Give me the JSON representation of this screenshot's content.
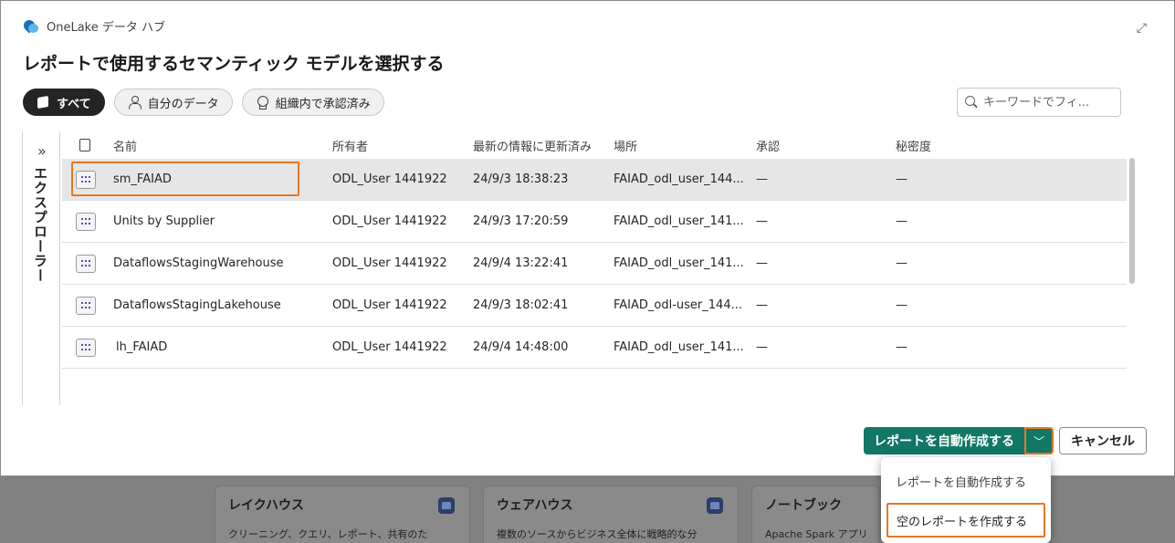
{
  "background": {
    "cards": [
      {
        "title": "レイクハウス",
        "desc": "クリーニング、クエリ、レポート、共有のた"
      },
      {
        "title": "ウェアハウス",
        "desc": "複数のソースからビジネス全体に戦略的な分"
      },
      {
        "title": "ノートブック",
        "desc": "Apache Spark アプリケ"
      }
    ]
  },
  "dialog": {
    "hub_name": "OneLake データ ハブ",
    "title": "レポートで使用するセマンティック モデルを選択する",
    "filters": [
      "すべて",
      "自分のデータ",
      "組織内で承認済み"
    ],
    "search_placeholder": "キーワードでフィ...",
    "explorer_label": "エクスプローラー",
    "columns": [
      "名前",
      "所有者",
      "最新の情報に更新済み",
      "場所",
      "承認",
      "秘密度"
    ],
    "rows": [
      {
        "name": "sm_FAIAD",
        "owner": "ODL_User 1441922",
        "refreshed": "24/9/3 18:38:23",
        "location": "FAIAD_odl_user_144...",
        "endorsement": "—",
        "sensitivity": "—"
      },
      {
        "name": "Units by Supplier",
        "owner": "ODL_User 1441922",
        "refreshed": "24/9/3 17:20:59",
        "location": "FAIAD_odl_user_141...",
        "endorsement": "—",
        "sensitivity": "—"
      },
      {
        "name": "DataflowsStagingWarehouse",
        "owner": "ODL_User 1441922",
        "refreshed": "24/9/4 13:22:41",
        "location": "FAIAD_odl_user_141...",
        "endorsement": "—",
        "sensitivity": "—"
      },
      {
        "name": "DataflowsStagingLakehouse",
        "owner": "ODL_User 1441922",
        "refreshed": "24/9/3 18:02:41",
        "location": "FAIAD_odl-user_144...",
        "endorsement": "—",
        "sensitivity": "—"
      },
      {
        "name": "lh_FAIAD",
        "owner": "ODL_User 1441922",
        "refreshed": "24/9/4 14:48:00",
        "location": "FAIAD_odl_user_141...",
        "endorsement": "—",
        "sensitivity": "—"
      }
    ],
    "buttons": {
      "auto_create": "レポートを自動作成する",
      "cancel": "キャンセル"
    },
    "menu": [
      "レポートを自動作成する",
      "空のレポートを作成する"
    ],
    "accent_color": "#117865",
    "highlight_color": "#e87722"
  }
}
